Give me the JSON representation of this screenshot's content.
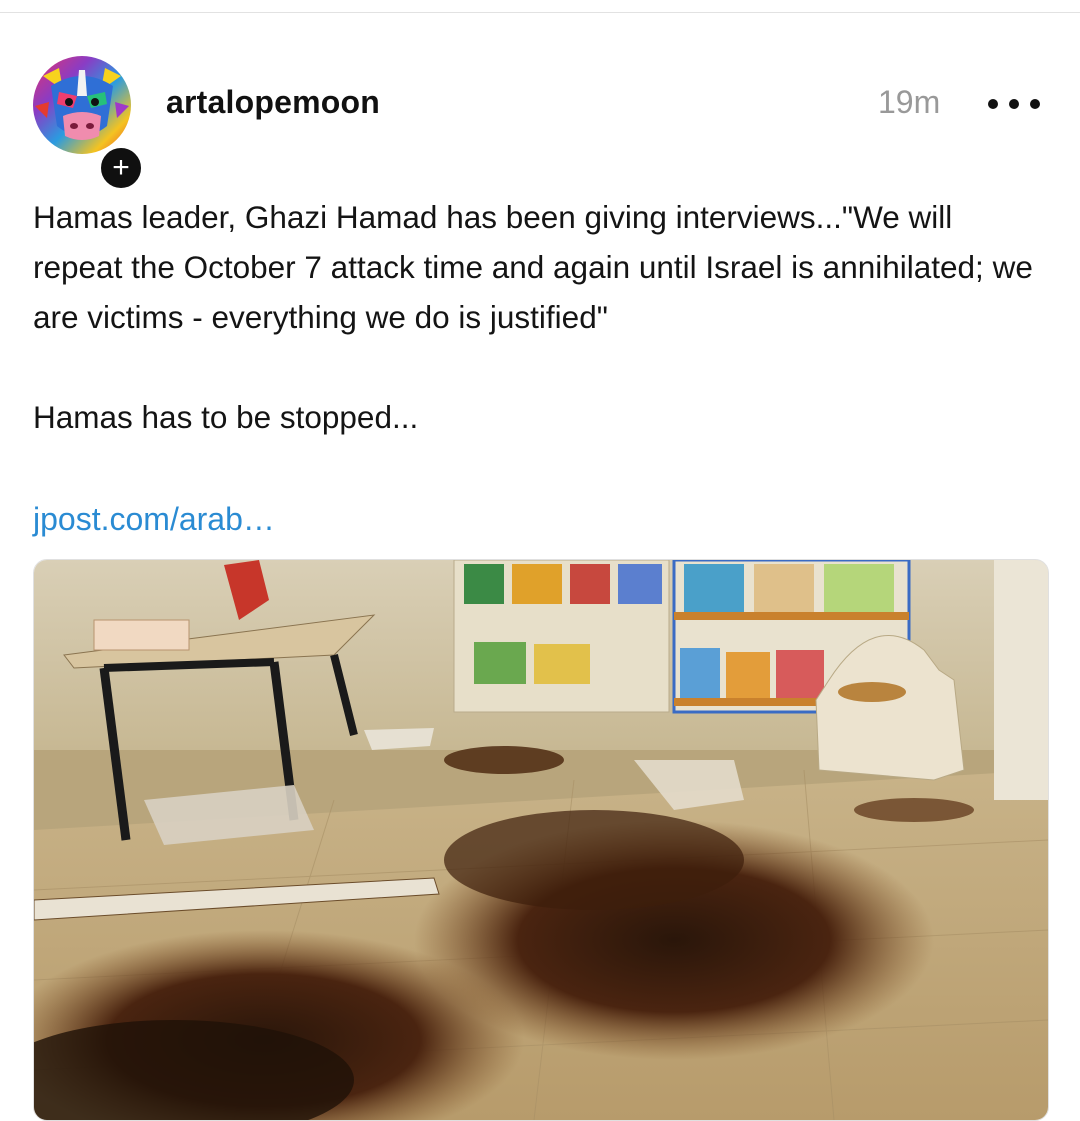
{
  "post": {
    "author": {
      "username": "artalopemoon",
      "avatar_icon": "colorful-painted-cow-avatar",
      "follow_icon": "plus-icon"
    },
    "time": "19m",
    "more_icon": "more-horizontal-icon",
    "body": {
      "paragraph_1": "Hamas leader, Ghazi Hamad has been giving interviews...\"We will repeat the October 7 attack time and again until Israel is annihilated; we are victims - everything we do is justified\"",
      "paragraph_2": "Hamas has to be stopped..."
    },
    "link": {
      "text": "jpost.com/arab…"
    },
    "media": {
      "type": "photo",
      "subject": "damaged kindergarten classroom"
    }
  },
  "colors": {
    "link": "#2a8bd3",
    "timestamp": "#999999",
    "text": "#141414"
  }
}
